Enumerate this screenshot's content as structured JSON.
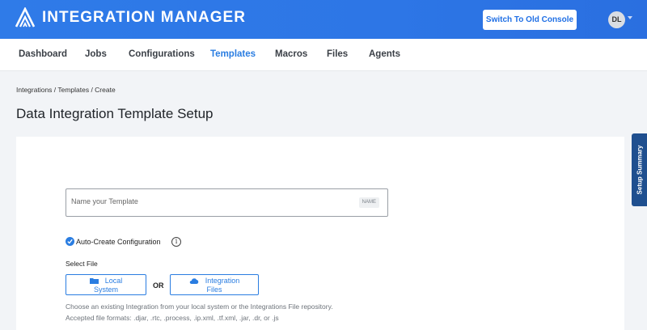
{
  "header": {
    "app_title": "INTEGRATION MANAGER",
    "switch_button": "Switch To Old Console",
    "avatar_initials": "DL",
    "bg_color": "#2f7be8",
    "logo_icon": "mountain-logo-icon"
  },
  "nav": {
    "items": [
      {
        "label": "Dashboard",
        "active": false
      },
      {
        "label": "Jobs",
        "active": false
      },
      {
        "label": "Configurations",
        "active": false
      },
      {
        "label": "Templates",
        "active": true
      },
      {
        "label": "Macros",
        "active": false
      },
      {
        "label": "Files",
        "active": false
      },
      {
        "label": "Agents",
        "active": false
      }
    ],
    "active_color": "#2a7de1"
  },
  "breadcrumb": "Integrations / Templates / Create",
  "page_title": "Data Integration Template Setup",
  "form": {
    "name_placeholder": "Name your Template",
    "name_value": "",
    "name_badge": "NAME",
    "auto_create_label": "Auto-Create Configuration",
    "auto_create_checked": true,
    "select_file_label": "Select File",
    "local_system": {
      "line1": "Local",
      "line2": "System",
      "icon": "folder-icon"
    },
    "or_label": "OR",
    "integration_files": {
      "line1": "Integration",
      "line2": "Files",
      "icon": "cloud-icon"
    },
    "help_line1": "Choose an existing Integration from your local system or the Integrations File repository.",
    "help_line2": "Accepted file formats: .djar, .rtc, .process, .ip.xml, .tf.xml, .jar, .dr, or .js"
  },
  "side_tab": "Setup Summary"
}
